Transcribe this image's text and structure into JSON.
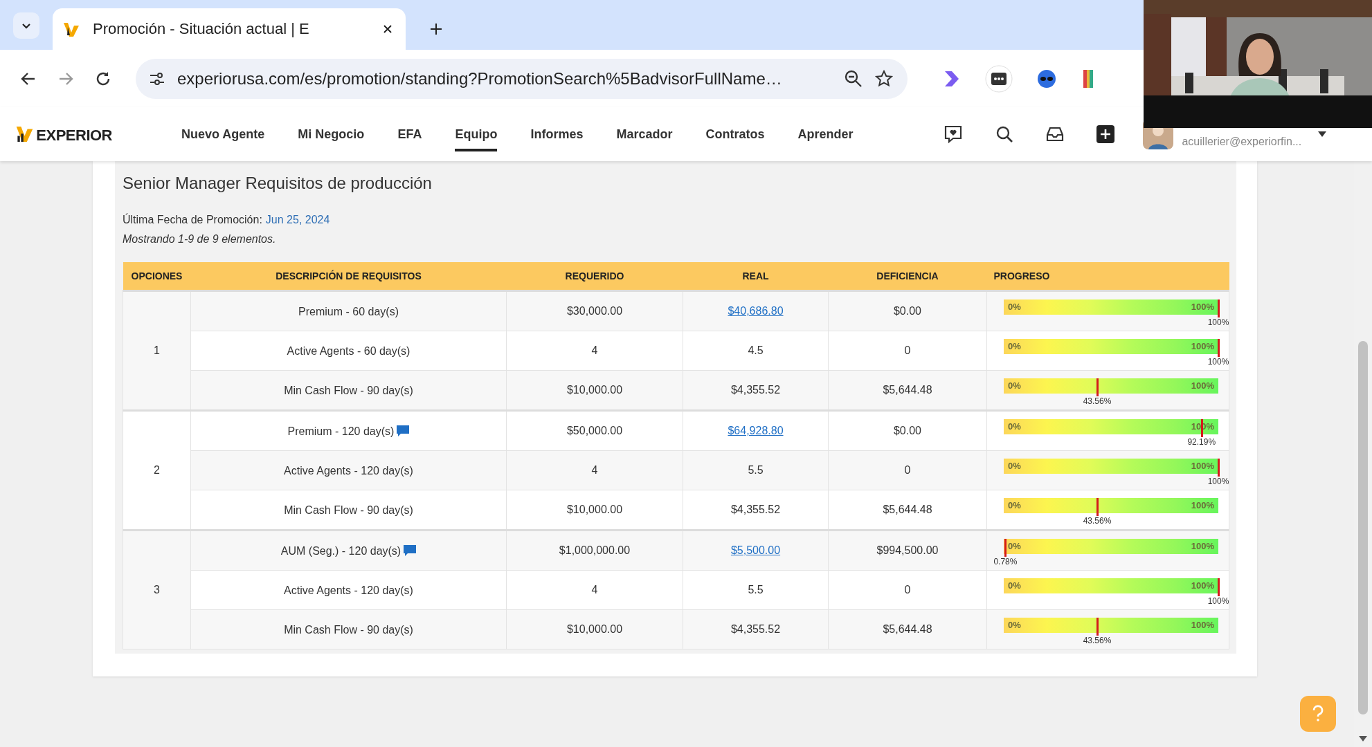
{
  "browser": {
    "tab": {
      "title": "Promoción - Situación actual | E",
      "selected": true
    },
    "url": "experiorusa.com/es/promotion/standing?PromotionSearch%5BadvisorFullName…"
  },
  "nav": {
    "logo": "EXPERIOR",
    "items": [
      {
        "label": "Nuevo Agente",
        "selected": false
      },
      {
        "label": "Mi Negocio",
        "selected": false
      },
      {
        "label": "EFA",
        "selected": false
      },
      {
        "label": "Equipo",
        "selected": true
      },
      {
        "label": "Informes",
        "selected": false
      },
      {
        "label": "Marcador",
        "selected": false
      },
      {
        "label": "Contratos",
        "selected": false
      },
      {
        "label": "Aprender",
        "selected": false
      }
    ],
    "user_email": "acuillerier@experiorfin..."
  },
  "section": {
    "title": "Senior Manager Requisitos de producción",
    "promo_label": "Última Fecha de Promoción:",
    "promo_date": "Jun 25, 2024",
    "summary": "Mostrando 1-9 de 9 elementos."
  },
  "table": {
    "columns": [
      "OPCIONES",
      "DESCRIPCIÓN DE REQUISITOS",
      "REQUERIDO",
      "REAL",
      "DEFICIENCIA",
      "PROGRESO"
    ],
    "options": [
      {
        "label": "1",
        "requirements": [
          {
            "description": "Premium - 60 day(s)",
            "note": false,
            "required": "$30,000.00",
            "actual": "$40,686.80",
            "linked": true,
            "deficiency": "$0.00",
            "scale_start": "0%",
            "scale_end": "100%",
            "level": 1,
            "reading": "100%"
          },
          {
            "description": "Active Agents - 60 day(s)",
            "note": false,
            "required": "4",
            "actual": "4.5",
            "linked": false,
            "deficiency": "0",
            "scale_start": "0%",
            "scale_end": "100%",
            "level": 1,
            "reading": "100%"
          },
          {
            "description": "Min Cash Flow - 90 day(s)",
            "note": false,
            "required": "$10,000.00",
            "actual": "$4,355.52",
            "linked": false,
            "deficiency": "$5,644.48",
            "scale_start": "0%",
            "scale_end": "100%",
            "level": 0.4356,
            "reading": "43.56%"
          }
        ]
      },
      {
        "label": "2",
        "requirements": [
          {
            "description": "Premium - 120 day(s)",
            "note": true,
            "required": "$50,000.00",
            "actual": "$64,928.80",
            "linked": true,
            "deficiency": "$0.00",
            "scale_start": "0%",
            "scale_end": "100%",
            "level": 0.9219,
            "reading": "92.19%"
          },
          {
            "description": "Active Agents - 120 day(s)",
            "note": false,
            "required": "4",
            "actual": "5.5",
            "linked": false,
            "deficiency": "0",
            "scale_start": "0%",
            "scale_end": "100%",
            "level": 1,
            "reading": "100%"
          },
          {
            "description": "Min Cash Flow - 90 day(s)",
            "note": false,
            "required": "$10,000.00",
            "actual": "$4,355.52",
            "linked": false,
            "deficiency": "$5,644.48",
            "scale_start": "0%",
            "scale_end": "100%",
            "level": 0.4356,
            "reading": "43.56%"
          }
        ]
      },
      {
        "label": "3",
        "requirements": [
          {
            "description": "AUM (Seg.) - 120 day(s)",
            "note": true,
            "required": "$1,000,000.00",
            "actual": "$5,500.00",
            "linked": true,
            "deficiency": "$994,500.00",
            "scale_start": "0%",
            "scale_end": "100%",
            "level": 0.0078,
            "reading": "0.78%"
          },
          {
            "description": "Active Agents - 120 day(s)",
            "note": false,
            "required": "4",
            "actual": "5.5",
            "linked": false,
            "deficiency": "0",
            "scale_start": "0%",
            "scale_end": "100%",
            "level": 1,
            "reading": "100%"
          },
          {
            "description": "Min Cash Flow - 90 day(s)",
            "note": false,
            "required": "$10,000.00",
            "actual": "$4,355.52",
            "linked": false,
            "deficiency": "$5,644.48",
            "scale_start": "0%",
            "scale_end": "100%",
            "level": 0.4356,
            "reading": "43.56%"
          }
        ]
      }
    ]
  }
}
